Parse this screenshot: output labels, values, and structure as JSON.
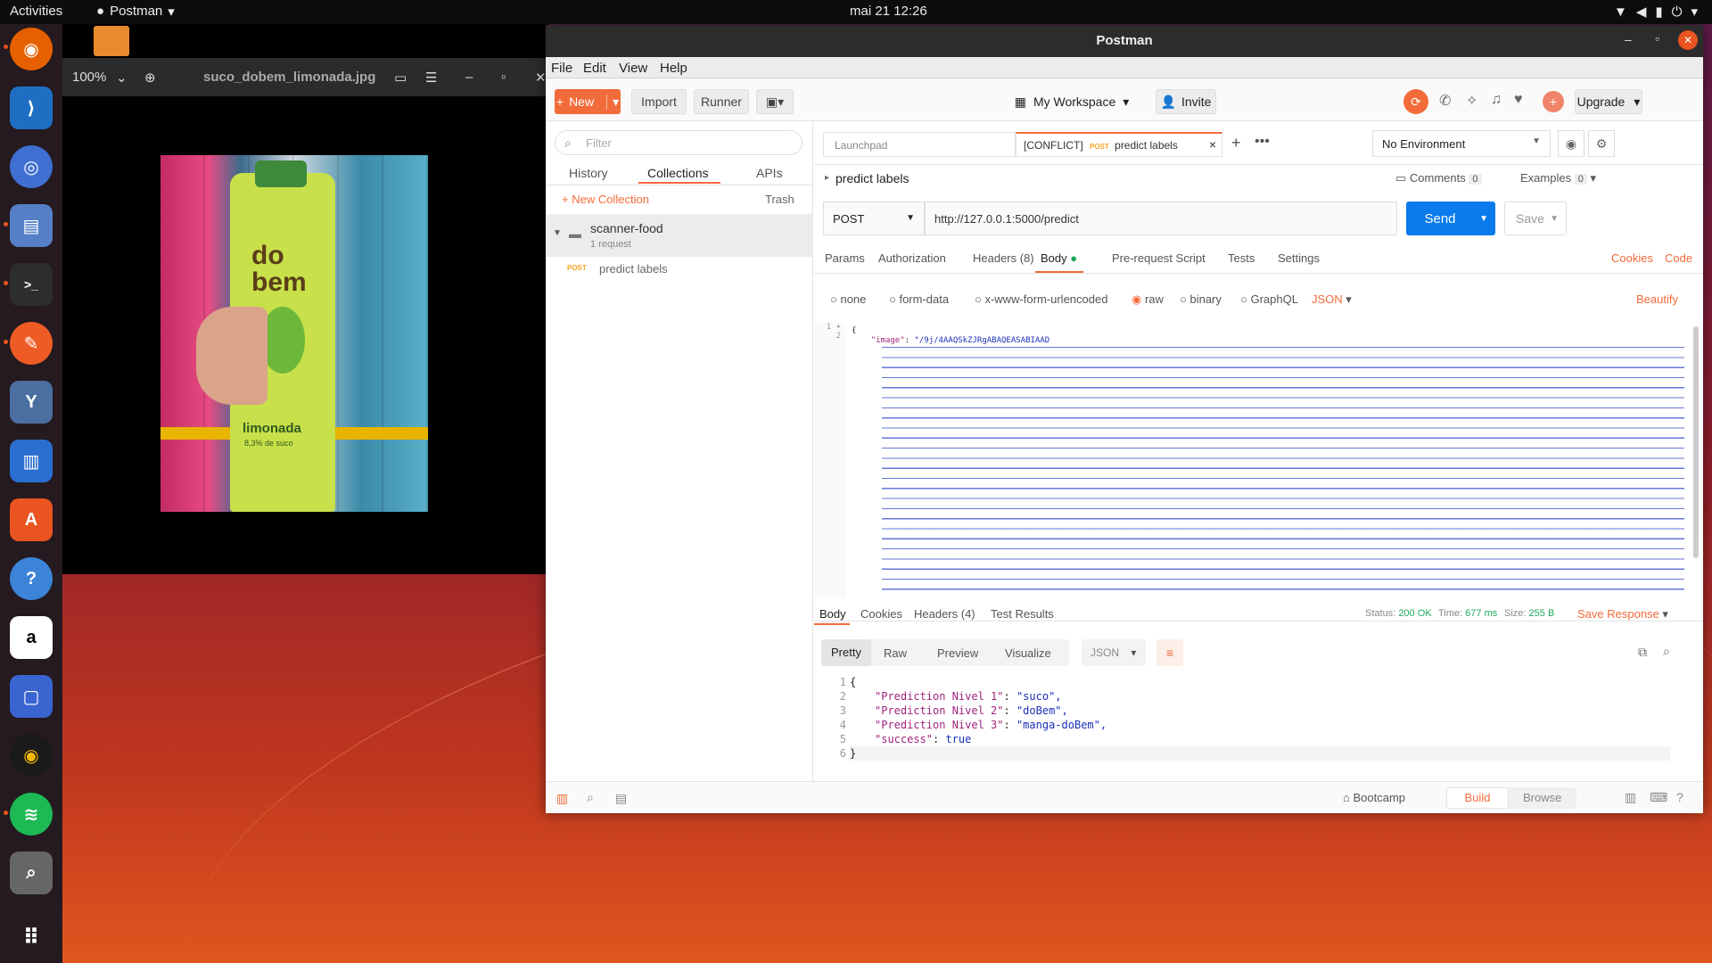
{
  "topbar": {
    "activities": "Activities",
    "app": "Postman",
    "clock": "mai 21  12:26"
  },
  "viewer": {
    "zoom": "100%",
    "filename": "suco_dobem_limonada.jpg",
    "product_brand": "do bem",
    "product_name": "limonada",
    "product_sub": "8,3% de suco"
  },
  "postman": {
    "title": "Postman",
    "menu": [
      "File",
      "Edit",
      "View",
      "Help"
    ],
    "toolbar": {
      "new": "New",
      "import": "Import",
      "runner": "Runner",
      "workspace": "My Workspace",
      "invite": "Invite",
      "upgrade": "Upgrade"
    },
    "sidebar": {
      "filter_placeholder": "Filter",
      "tabs": [
        "History",
        "Collections",
        "APIs"
      ],
      "new_collection": "New Collection",
      "trash": "Trash",
      "collection": {
        "name": "scanner-food",
        "count": "1 request"
      },
      "request": {
        "method": "POST",
        "name": "predict labels"
      }
    },
    "tabs": {
      "launchpad": "Launchpad",
      "active_prefix": "[CONFLICT]",
      "active_method": "POST",
      "active_name": "predict labels"
    },
    "environment": "No Environment",
    "request": {
      "name": "predict labels",
      "comments": "Comments",
      "comments_count": "0",
      "examples": "Examples",
      "examples_count": "0",
      "method": "POST",
      "url": "http://127.0.0.1:5000/predict",
      "send": "Send",
      "save": "Save",
      "tabs": [
        "Params",
        "Authorization",
        "Headers (8)",
        "Body",
        "Pre-request Script",
        "Tests",
        "Settings"
      ],
      "cookies": "Cookies",
      "code": "Code",
      "body_types": [
        "none",
        "form-data",
        "x-www-form-urlencoded",
        "raw",
        "binary",
        "GraphQL"
      ],
      "format": "JSON",
      "beautify": "Beautify",
      "body_line1": "{",
      "body_key": "\"image\"",
      "body_value_start": "\"/9j/4AAQSkZJRgABAQEASABIAAD"
    },
    "response": {
      "tabs": [
        "Body",
        "Cookies",
        "Headers (4)",
        "Test Results"
      ],
      "status_label": "Status:",
      "status": "200 OK",
      "time_label": "Time:",
      "time": "677 ms",
      "size_label": "Size:",
      "size": "255 B",
      "save_response": "Save Response",
      "views": [
        "Pretty",
        "Raw",
        "Preview",
        "Visualize"
      ],
      "format": "JSON",
      "lines": [
        {
          "n": "1",
          "text": "{"
        },
        {
          "n": "2",
          "key": "\"Prediction Nivel 1\"",
          "val": "\"suco\","
        },
        {
          "n": "3",
          "key": "\"Prediction Nivel 2\"",
          "val": "\"doBem\","
        },
        {
          "n": "4",
          "key": "\"Prediction Nivel 3\"",
          "val": "\"manga-doBem\","
        },
        {
          "n": "5",
          "key": "\"success\"",
          "val": "true"
        },
        {
          "n": "6",
          "text": "}"
        }
      ]
    },
    "statusbar": {
      "bootcamp": "Bootcamp",
      "build": "Build",
      "browse": "Browse"
    }
  },
  "colors": {
    "accent": "#f26b3a",
    "send": "#097bed",
    "get_post": "#f5a623",
    "status_ok": "#1aa85a"
  }
}
